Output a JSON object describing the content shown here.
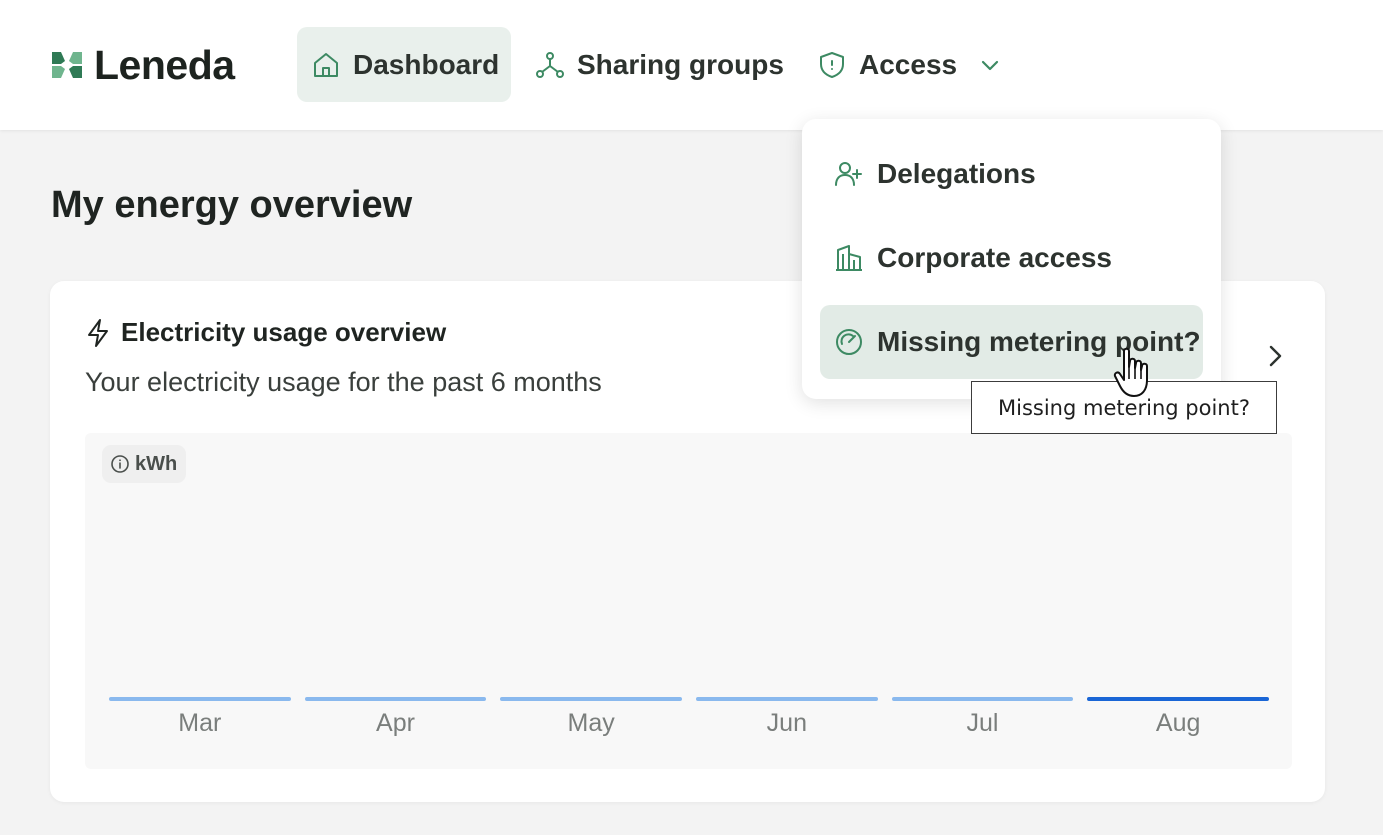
{
  "header": {
    "brand": "Leneda",
    "nav": {
      "dashboard": "Dashboard",
      "sharing_groups": "Sharing groups",
      "access": "Access"
    }
  },
  "main": {
    "title": "My energy overview",
    "card": {
      "title": "Electricity usage overview",
      "subtitle": "Your electricity usage for the past 6 months",
      "unit": "kWh",
      "months": [
        "Mar",
        "Apr",
        "May",
        "Jun",
        "Jul",
        "Aug"
      ]
    }
  },
  "dropdown": {
    "items": [
      {
        "label": "Delegations",
        "icon": "user-plus-icon"
      },
      {
        "label": "Corporate access",
        "icon": "building-icon"
      },
      {
        "label": "Missing metering point?",
        "icon": "gauge-icon"
      }
    ],
    "tooltip": "Missing metering point?"
  },
  "colors": {
    "brand_green": "#3d8a63",
    "active_nav_bg": "#e9f0ec",
    "hover_item_bg": "#e2ebe6",
    "bar_line_light": "#8ab9ee",
    "bar_line_active": "#1a66d6"
  },
  "chart_data": {
    "type": "bar",
    "categories": [
      "Mar",
      "Apr",
      "May",
      "Jun",
      "Jul",
      "Aug"
    ],
    "values": [
      0,
      0,
      0,
      0,
      0,
      0
    ],
    "ylabel": "kWh",
    "title": "",
    "xlabel": ""
  }
}
